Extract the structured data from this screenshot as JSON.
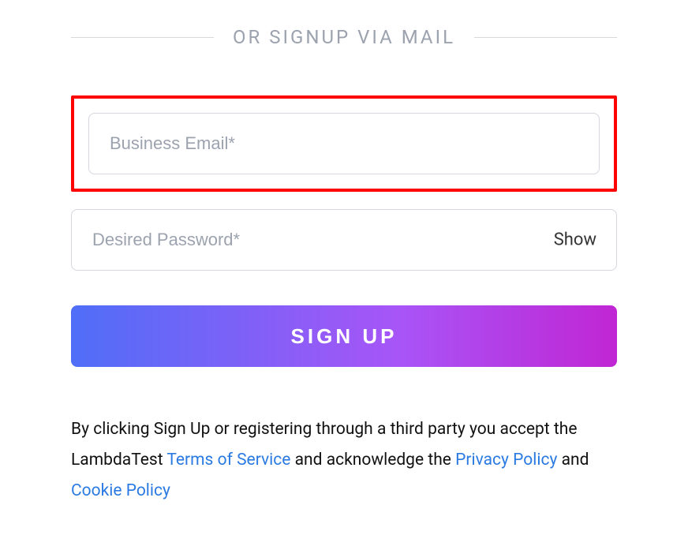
{
  "divider": {
    "text": "OR SIGNUP VIA MAIL"
  },
  "form": {
    "email": {
      "placeholder": "Business Email*",
      "value": ""
    },
    "password": {
      "placeholder": "Desired Password*",
      "value": "",
      "toggle_label": "Show"
    },
    "submit_label": "SIGN UP"
  },
  "legal": {
    "prefix": "By clicking Sign Up or registering through a third party you accept the LambdaTest ",
    "terms_label": "Terms of Service",
    "mid": " and acknowledge the ",
    "privacy_label": "Privacy Policy",
    "and": " and ",
    "cookie_label": "Cookie Policy"
  }
}
